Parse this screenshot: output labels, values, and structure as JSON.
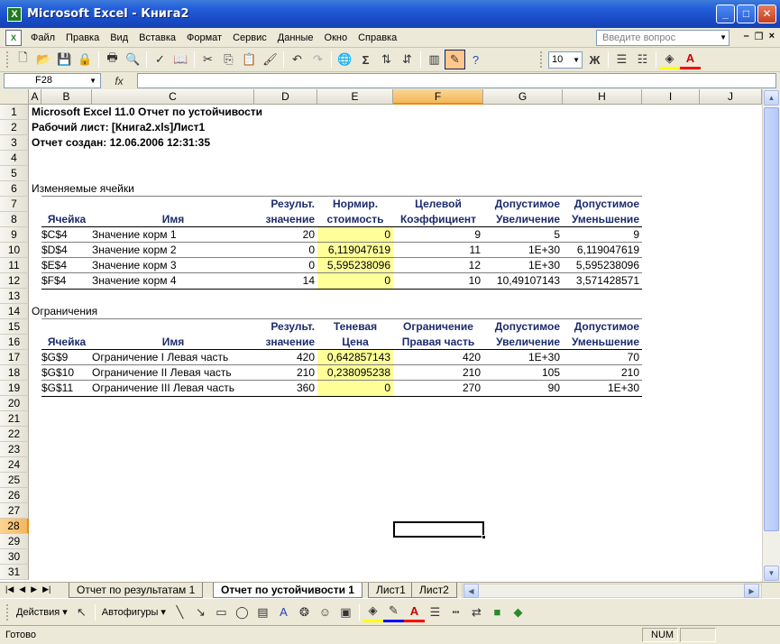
{
  "window": {
    "title": "Microsoft Excel - Книга2"
  },
  "menu": {
    "items": [
      "Файл",
      "Правка",
      "Вид",
      "Вставка",
      "Формат",
      "Сервис",
      "Данные",
      "Окно",
      "Справка"
    ],
    "help_placeholder": "Введите вопрос"
  },
  "toolbar": {
    "font_size": "10",
    "bold_label": "Ж"
  },
  "formula": {
    "namebox": "F28",
    "fx": "fx"
  },
  "columns": [
    "A",
    "B",
    "C",
    "D",
    "E",
    "F",
    "G",
    "H",
    "I",
    "J"
  ],
  "rows": [
    "1",
    "2",
    "3",
    "4",
    "5",
    "6",
    "7",
    "8",
    "9",
    "10",
    "11",
    "12",
    "13",
    "14",
    "15",
    "16",
    "17",
    "18",
    "19",
    "20",
    "21",
    "22",
    "23",
    "24",
    "25",
    "26",
    "27",
    "28",
    "29",
    "30",
    "31"
  ],
  "report": {
    "title": "Microsoft Excel 11.0 Отчет по устойчивости",
    "worksheet": "Рабочий лист: [Книга2.xls]Лист1",
    "created": "Отчет создан: 12.06.2006 12:31:35",
    "changing_section": "Изменяемые ячейки",
    "changing_headers": {
      "d1": "Результ.",
      "d2": "значение",
      "e1": "Нормир.",
      "e2": "стоимость",
      "f1": "Целевой",
      "f2": "Коэффициент",
      "g1": "Допустимое",
      "g2": "Увеличение",
      "h1": "Допустимое",
      "h2": "Уменьшение",
      "b": "Ячейка",
      "c": "Имя"
    },
    "changing_rows": [
      {
        "cell": "$C$4",
        "name": "Значение корм 1",
        "value": "20",
        "cost": "0",
        "coef": "9",
        "inc": "5",
        "dec": "9"
      },
      {
        "cell": "$D$4",
        "name": "Значение корм 2",
        "value": "0",
        "cost": "6,119047619",
        "coef": "11",
        "inc": "1E+30",
        "dec": "6,119047619"
      },
      {
        "cell": "$E$4",
        "name": "Значение корм 3",
        "value": "0",
        "cost": "5,595238096",
        "coef": "12",
        "inc": "1E+30",
        "dec": "5,595238096"
      },
      {
        "cell": "$F$4",
        "name": "Значение корм 4",
        "value": "14",
        "cost": "0",
        "coef": "10",
        "inc": "10,49107143",
        "dec": "3,571428571"
      }
    ],
    "constraints_section": "Ограничения",
    "constraint_headers": {
      "d1": "Результ.",
      "d2": "значение",
      "e1": "Теневая",
      "e2": "Цена",
      "f1": "Ограничение",
      "f2": "Правая часть",
      "g1": "Допустимое",
      "g2": "Увеличение",
      "h1": "Допустимое",
      "h2": "Уменьшение",
      "b": "Ячейка",
      "c": "Имя"
    },
    "constraint_rows": [
      {
        "cell": "$G$9",
        "name": "Ограничение I Левая часть",
        "value": "420",
        "price": "0,642857143",
        "rhs": "420",
        "inc": "1E+30",
        "dec": "70"
      },
      {
        "cell": "$G$10",
        "name": "Ограничение II Левая часть",
        "value": "210",
        "price": "0,238095238",
        "rhs": "210",
        "inc": "105",
        "dec": "210"
      },
      {
        "cell": "$G$11",
        "name": "Ограничение III Левая часть",
        "value": "360",
        "price": "0",
        "rhs": "270",
        "inc": "90",
        "dec": "1E+30"
      }
    ]
  },
  "sheets": {
    "tabs": [
      "Отчет по результатам 1",
      "Отчет по устойчивости 1",
      "Лист1",
      "Лист2"
    ],
    "active": 1
  },
  "drawing": {
    "actions": "Действия ▾",
    "autoshapes": "Автофигуры ▾"
  },
  "status": {
    "ready": "Готово",
    "num": "NUM"
  }
}
